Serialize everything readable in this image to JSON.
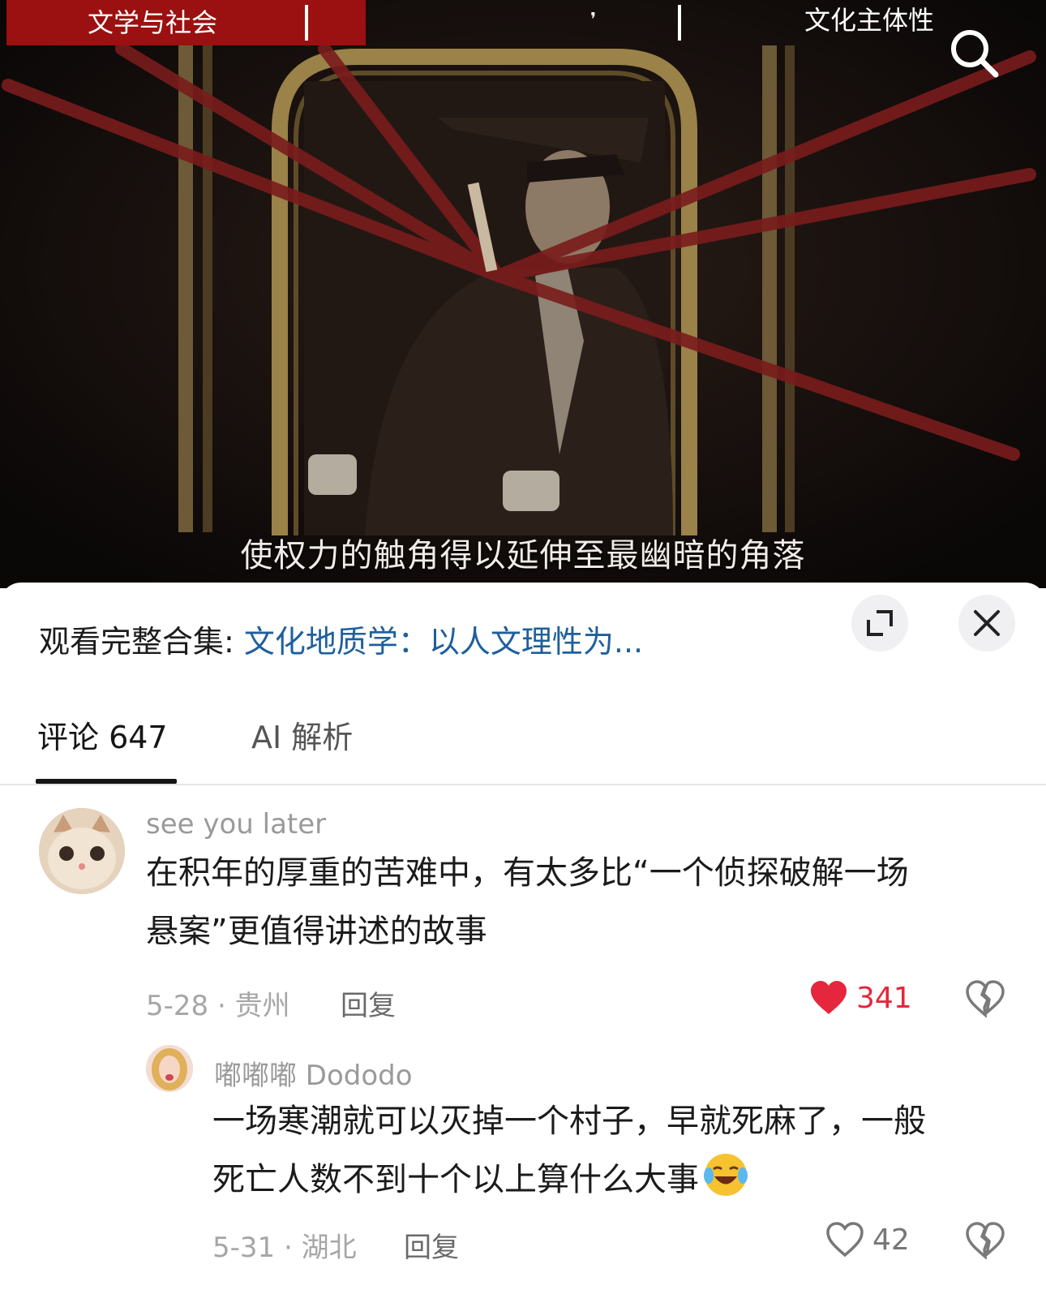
{
  "video": {
    "tag_left": "文学与社会",
    "tag_right": "文化主体性",
    "subtitle": "使权力的触角得以延伸至最幽暗的角落",
    "search_icon": "search-icon"
  },
  "sheet": {
    "collection_prefix": "观看完整合集: ",
    "collection_title": "文化地质学：以人文理性为...",
    "expand_icon": "expand-icon",
    "close_icon": "close-icon"
  },
  "tabs": {
    "comments": "评论 647",
    "ai": "AI 解析"
  },
  "comments": [
    {
      "username": "see you later",
      "text_line1": "在积年的厚重的苦难中，有太多比“一个侦探破解一场",
      "text_line2": "悬案”更值得讲述的故事",
      "meta": "5-28 · 贵州",
      "reply": "回复",
      "likes": "341",
      "liked": true
    },
    {
      "username": "嘟嘟嘟 Dododo",
      "text_line1": "一场寒潮就可以灭掉一个村子，早就死麻了，一般",
      "text_line2": "死亡人数不到十个以上算什么大事",
      "meta": "5-31 · 湖北",
      "reply": "回复",
      "likes": "42",
      "liked": false
    }
  ],
  "colors": {
    "accent_red": "#9b1010",
    "like_red": "#e5263c",
    "link_blue": "#1f5f9c"
  }
}
